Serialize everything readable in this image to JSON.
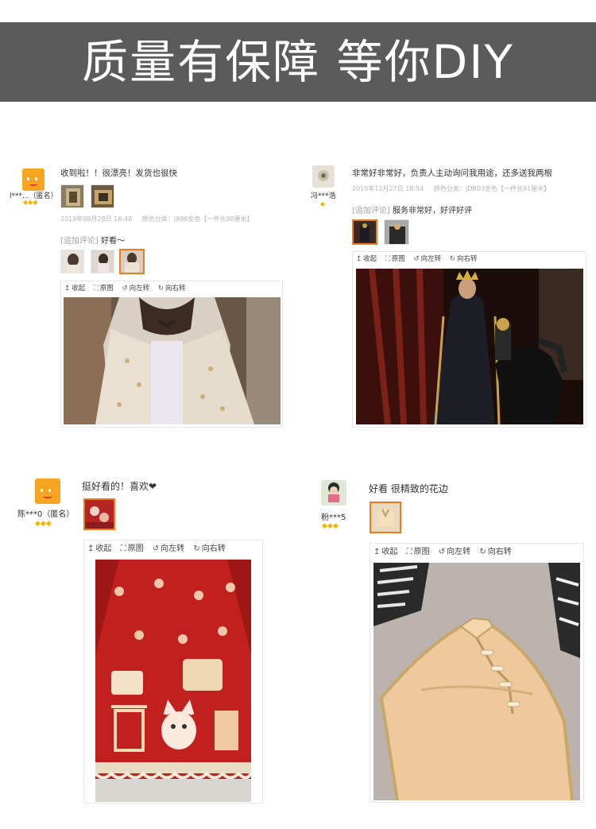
{
  "banner": {
    "title": "质量有保障 等你DIY"
  },
  "reviews": [
    {
      "username": "l***...（匿名）",
      "level": "◆◆◆",
      "text": "收到啦！！很漂亮！发货也很快",
      "date": "2019年08月28日 16:48",
      "sku": "颜色分类：J896金色【一件长90厘米】",
      "append_tag": "[追加评论]",
      "append_text": "好看～",
      "toolbar": {
        "collapse": "收起",
        "original": "原图",
        "rotate_left": "向左转",
        "rotate_right": "向右转"
      }
    },
    {
      "username": "冯***浩",
      "level": "◆",
      "text": "非常好非常好，负责人主动询问我用途，还多送我两根",
      "date": "2019年11月27日 18:54",
      "sku": "颜色分类：JDB03金色【一件长91厘米】",
      "append_tag": "[追加评论]",
      "append_text": "服务非常好，好评好评",
      "toolbar": {
        "collapse": "收起",
        "original": "原图",
        "rotate_left": "向左转",
        "rotate_right": "向右转"
      }
    },
    {
      "username": "陈***0（匿名）",
      "level": "◆◆◆",
      "text": "挺好看的！喜欢❤",
      "toolbar": {
        "collapse": "收起",
        "original": "原图",
        "rotate_left": "向左转",
        "rotate_right": "向右转"
      }
    },
    {
      "username": "粉***5",
      "level": "◆◆◆",
      "text": "好看 很精致的花边",
      "toolbar": {
        "collapse": "收起",
        "original": "原图",
        "rotate_left": "向左转",
        "rotate_right": "向右转"
      }
    }
  ],
  "icons": {
    "collapse": "arrow-up-icon",
    "original": "expand-icon",
    "rotate_left": "rotate-left-icon",
    "rotate_right": "rotate-right-icon"
  }
}
